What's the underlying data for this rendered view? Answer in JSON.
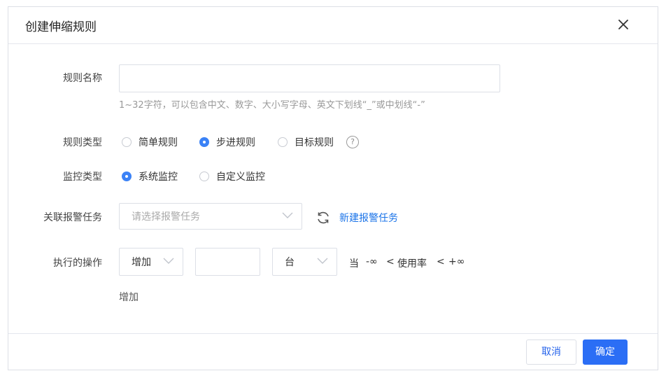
{
  "dialog": {
    "title": "创建伸缩规则",
    "close_icon": "close-icon"
  },
  "form": {
    "rule_name": {
      "label": "规则名称",
      "value": "",
      "hint": "1~32字符，可以包含中文、数字、大小写字母、英文下划线“_”或中划线“-”"
    },
    "rule_type": {
      "label": "规则类型",
      "options": [
        "简单规则",
        "步进规则",
        "目标规则"
      ],
      "selected": "步进规则",
      "help_icon": "question-circle-icon"
    },
    "monitor_type": {
      "label": "监控类型",
      "options": [
        "系统监控",
        "自定义监控"
      ],
      "selected": "系统监控"
    },
    "alarm_task": {
      "label": "关联报警任务",
      "placeholder": "请选择报警任务",
      "refresh_icon": "refresh-icon",
      "create_link": "新建报警任务"
    },
    "action": {
      "label": "执行的操作",
      "operation": "增加",
      "amount": "",
      "unit": "台",
      "cond_when": "当",
      "cond_min": "-∞",
      "cond_lt1": "<",
      "cond_metric": "使用率",
      "cond_lt2": "<",
      "cond_max": "+∞",
      "add_link": "增加"
    }
  },
  "footer": {
    "cancel_label": "取消",
    "ok_label": "确定"
  },
  "colors": {
    "accent": "#2b6ef5",
    "link": "#1a73e8",
    "radio_selected": "#3b82f6"
  }
}
